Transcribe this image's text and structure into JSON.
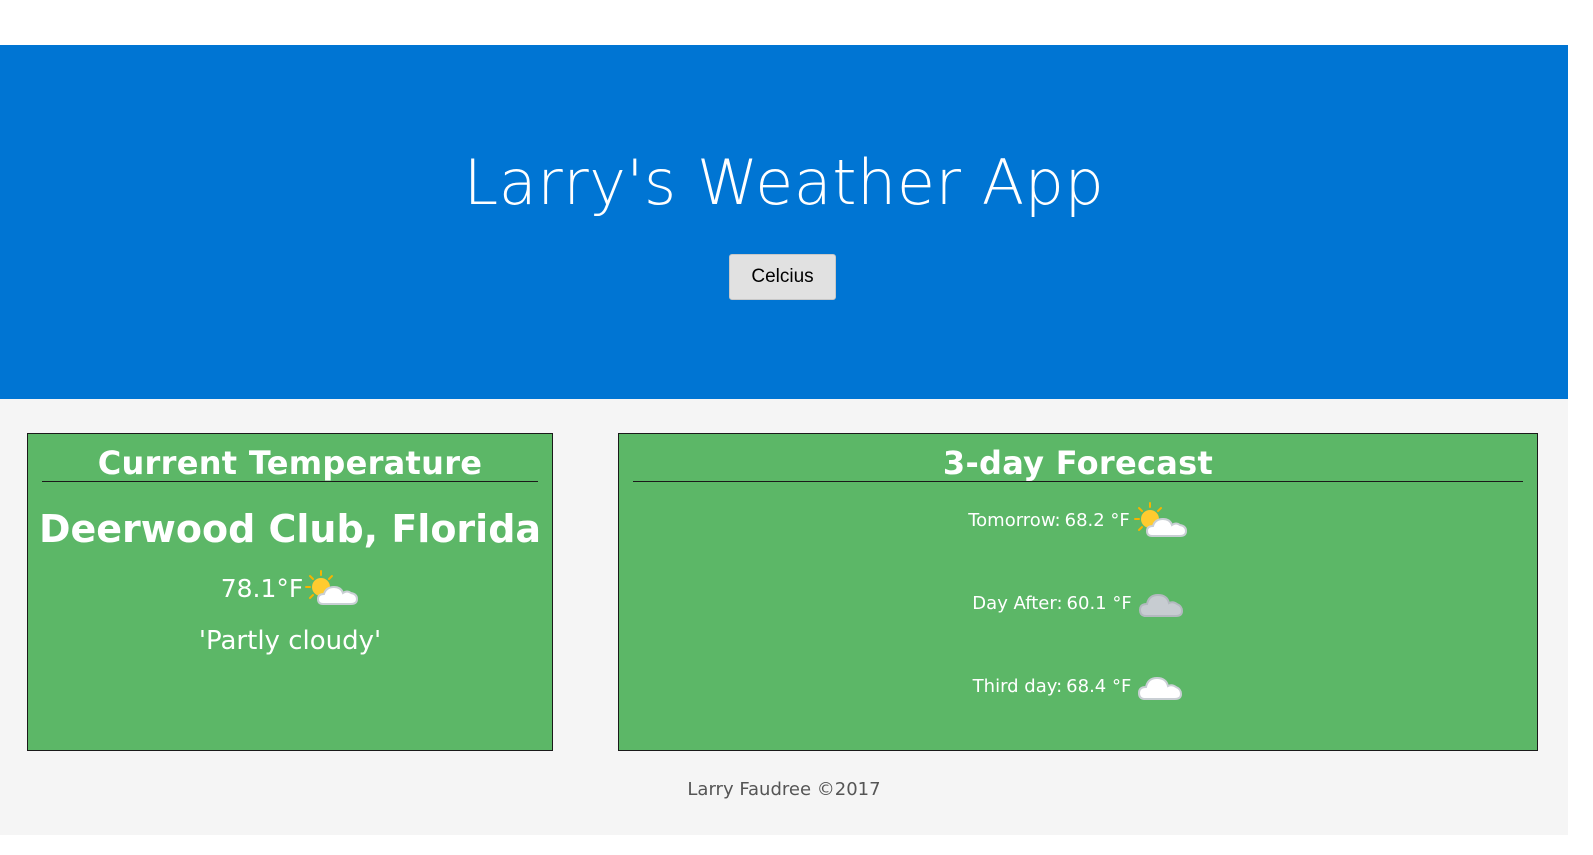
{
  "header": {
    "title": "Larry's Weather App",
    "unit_toggle_label": "Celcius"
  },
  "current": {
    "heading": "Current Temperature",
    "location": "Deerwood Club, Florida",
    "temperature": "78.1°F",
    "condition": "'Partly cloudy'",
    "icon": "partly-cloudy-icon"
  },
  "forecast": {
    "heading": "3-day Forecast",
    "days": [
      {
        "label": "Tomorrow:",
        "value": "68.2 °F",
        "icon": "partly-cloudy-icon"
      },
      {
        "label": "Day After:",
        "value": "60.1 °F",
        "icon": "cloud-gray-icon"
      },
      {
        "label": "Third day:",
        "value": "68.4 °F",
        "icon": "cloud-white-icon"
      }
    ]
  },
  "footer": {
    "text": "Larry Faudree ©2017"
  },
  "colors": {
    "hero_bg": "#0075d3",
    "card_bg": "#5cb767",
    "page_bg": "#f5f5f5"
  }
}
